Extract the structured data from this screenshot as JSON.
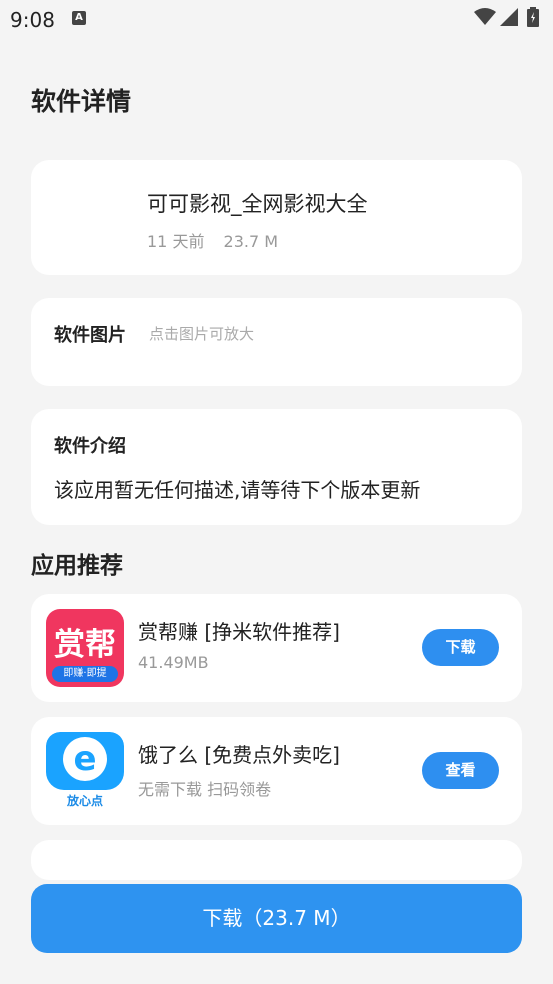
{
  "status": {
    "time": "9:08",
    "notif_icon": "A"
  },
  "page": {
    "title": "软件详情"
  },
  "app": {
    "name": "可可影视_全网影视大全",
    "updated": "11 天前",
    "size": "23.7 M"
  },
  "images": {
    "label": "软件图片",
    "hint": "点击图片可放大"
  },
  "intro": {
    "label": "软件介绍",
    "body": "该应用暂无任何描述,请等待下个版本更新"
  },
  "recommend": {
    "title": "应用推荐",
    "items": [
      {
        "name": "赏帮赚 [挣米软件推荐]",
        "sub": "41.49MB",
        "button": "下载",
        "icon_text": "赏帮",
        "icon_strip": "即赚·即提"
      },
      {
        "name": "饿了么 [免费点外卖吃]",
        "sub": "无需下载 扫码领卷",
        "button": "查看",
        "icon_text": "e",
        "icon_strip": "放心点"
      }
    ]
  },
  "download": {
    "label": "下载（23.7 M）"
  },
  "colors": {
    "accent": "#2e93f0",
    "background": "#f4f4f4",
    "card": "#ffffff"
  }
}
